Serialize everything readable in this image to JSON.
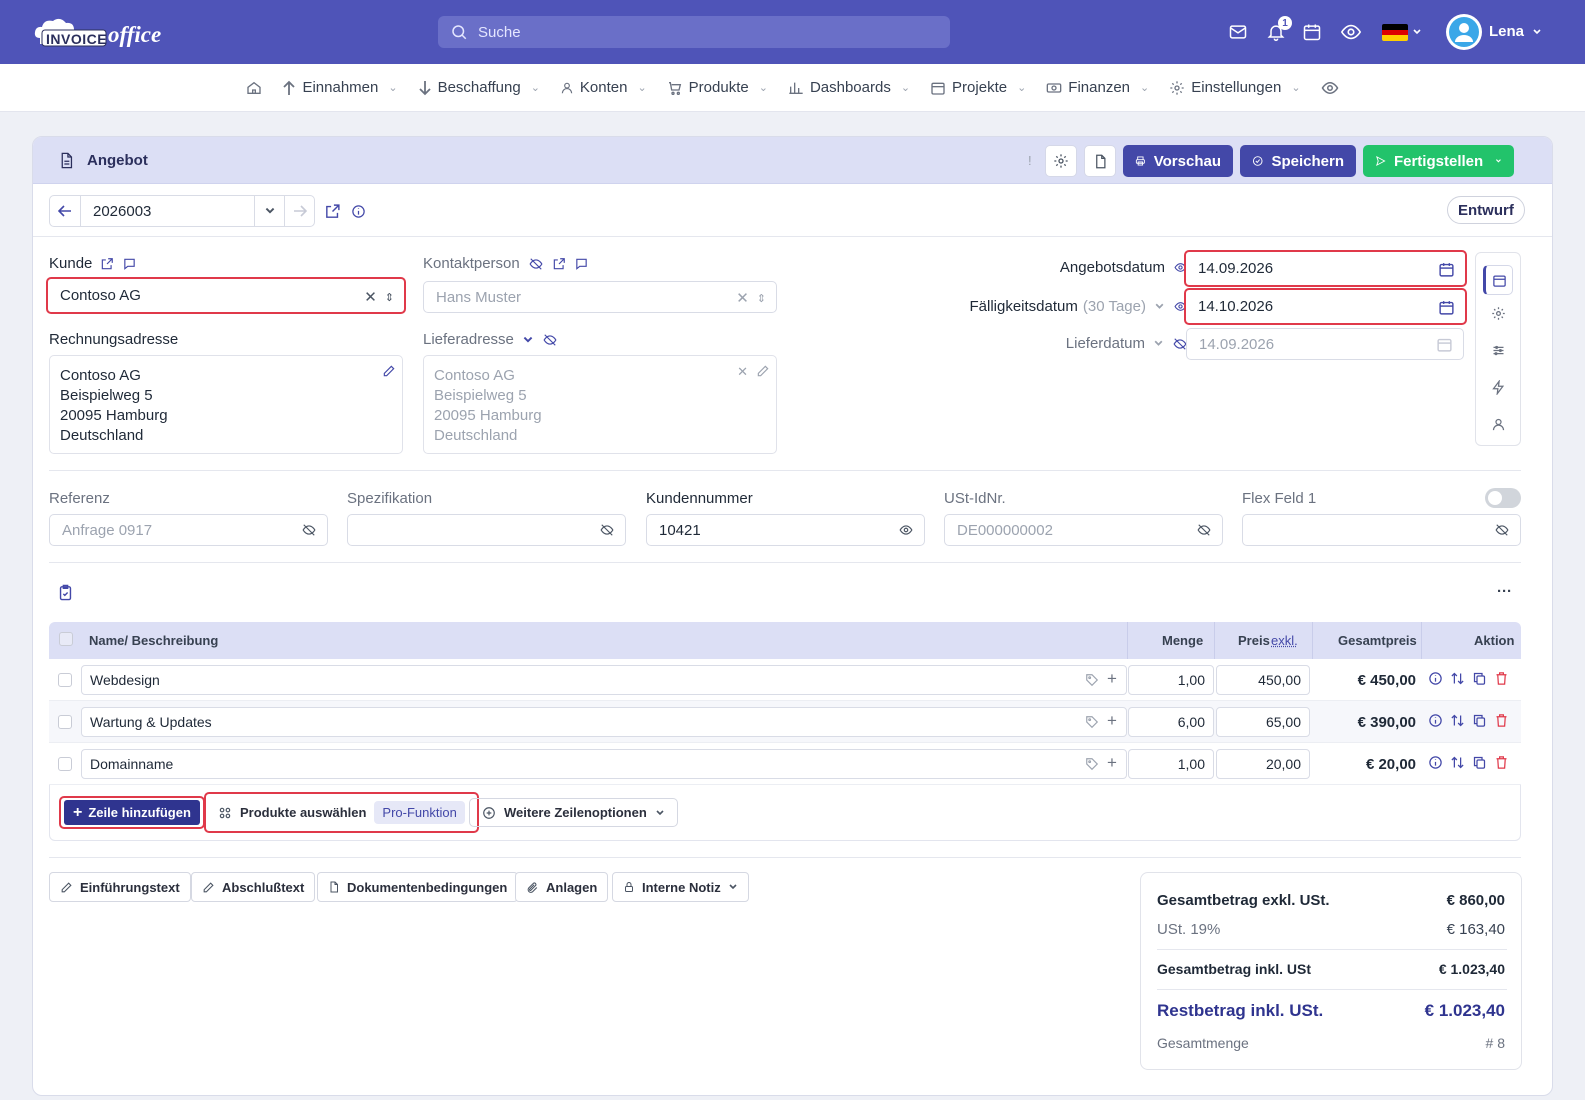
{
  "topbar": {
    "logo_text_1": "INVOICE",
    "logo_text_2": "office",
    "search_placeholder": "Suche",
    "notification_count": "1",
    "user_name": "Lena"
  },
  "nav": {
    "items": [
      {
        "label": "Einnahmen",
        "icon": "arrow-up-icon"
      },
      {
        "label": "Beschaffung",
        "icon": "arrow-down-icon"
      },
      {
        "label": "Konten",
        "icon": "user-icon"
      },
      {
        "label": "Produkte",
        "icon": "cart-icon"
      },
      {
        "label": "Dashboards",
        "icon": "chart-icon"
      },
      {
        "label": "Projekte",
        "icon": "calendar-icon"
      },
      {
        "label": "Finanzen",
        "icon": "money-icon"
      },
      {
        "label": "Einstellungen",
        "icon": "gear-icon"
      }
    ]
  },
  "header": {
    "title": "Angebot",
    "exclamation": "!",
    "preview_label": "Vorschau",
    "save_label": "Speichern",
    "finish_label": "Fertigstellen"
  },
  "doc": {
    "number": "2026003",
    "status": "Entwurf"
  },
  "customer": {
    "label": "Kunde",
    "value": "Contoso AG",
    "contact_label": "Kontaktperson",
    "contact_value": "Hans Muster",
    "billing_label": "Rechnungsadresse",
    "billing_lines": [
      "Contoso AG",
      "Beispielweg 5",
      "20095 Hamburg",
      "Deutschland"
    ],
    "delivery_label": "Lieferadresse",
    "delivery_lines": [
      "Contoso AG",
      "Beispielweg 5",
      "20095 Hamburg",
      "Deutschland"
    ]
  },
  "dates": {
    "offer_label": "Angebotsdatum",
    "offer_value": "14.09.2026",
    "due_label": "Fälligkeitsdatum",
    "due_hint": "(30 Tage)",
    "due_value": "14.10.2026",
    "delivery_label": "Lieferdatum",
    "delivery_value": "14.09.2026"
  },
  "fields": {
    "ref_label": "Referenz",
    "ref_value": "Anfrage 0917",
    "spec_label": "Spezifikation",
    "spec_value": "",
    "custno_label": "Kundennummer",
    "custno_value": "10421",
    "vat_label": "USt-IdNr.",
    "vat_value": "DE000000002",
    "flex_label": "Flex Feld 1",
    "flex_value": ""
  },
  "table": {
    "col_name": "Name/ Beschreibung",
    "col_qty": "Menge",
    "col_price": "Preis",
    "col_price_suffix": "exkl.",
    "col_total": "Gesamtpreis",
    "col_action": "Aktion",
    "rows": [
      {
        "name": "Webdesign",
        "qty": "1,00",
        "price": "450,00",
        "total": "€ 450,00"
      },
      {
        "name": "Wartung & Updates",
        "qty": "6,00",
        "price": "65,00",
        "total": "€ 390,00"
      },
      {
        "name": "Domainname",
        "qty": "1,00",
        "price": "20,00",
        "total": "€ 20,00"
      }
    ],
    "add_row_label": "Zeile hinzufügen",
    "select_products_label": "Produkte auswählen",
    "pro_badge": "Pro-Funktion",
    "more_options_label": "Weitere Zeilenoptionen",
    "more_menu": "···"
  },
  "footer_buttons": {
    "intro": "Einführungstext",
    "closing": "Abschlußtext",
    "conditions": "Dokumentenbedingungen",
    "attachments": "Anlagen",
    "internal_note": "Interne Notiz"
  },
  "summary": {
    "net_label": "Gesamtbetrag exkl. USt.",
    "net_value": "€ 860,00",
    "vat_label": "USt. 19%",
    "vat_value": "€ 163,40",
    "gross_label": "Gesamtbetrag inkl. USt",
    "gross_value": "€ 1.023,40",
    "rest_label": "Restbetrag inkl. USt.",
    "rest_value": "€ 1.023,40",
    "qty_label": "Gesamtmenge",
    "qty_value": "# 8"
  },
  "colors": {
    "primary": "#4f54b8",
    "button_blue": "#4348a8",
    "button_green": "#22c36b",
    "highlight_red": "#e0394a",
    "delete_red": "#e0394a"
  }
}
